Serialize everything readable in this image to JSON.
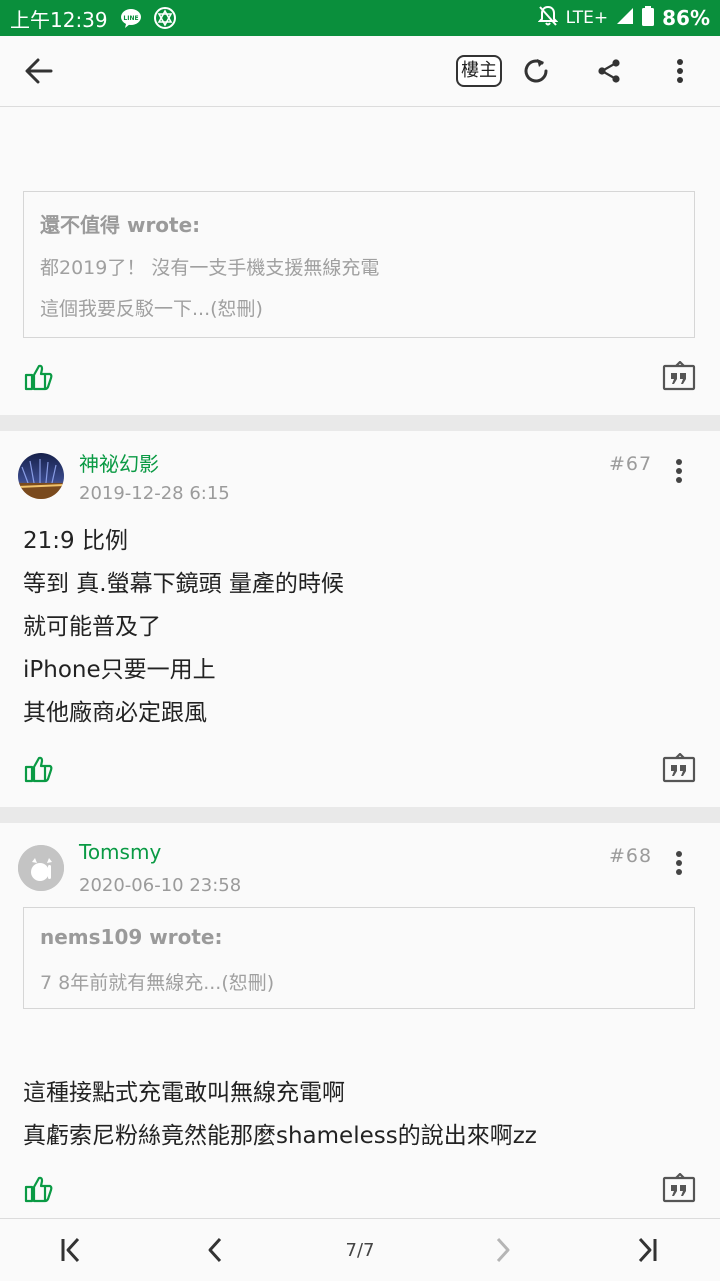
{
  "status_bar": {
    "time": "上午12:39",
    "network": "LTE+",
    "battery": "86%"
  },
  "toolbar": {
    "back_icon": "arrow-left-icon",
    "author_only_label": "樓主",
    "refresh_icon": "refresh-icon",
    "share_icon": "share-icon",
    "more_icon": "more-vertical-icon"
  },
  "posts": [
    {
      "quote": {
        "author": "還不值得 wrote:",
        "lines": [
          "都2019了！ 沒有一支手機支援無線充電",
          "這個我要反駁一下...(恕刪)"
        ]
      }
    },
    {
      "username": "神祕幻影",
      "datetime": "2019-12-28 6:15",
      "floor": "#67",
      "body": [
        "21:9 比例",
        "等到 真.螢幕下鏡頭 量產的時候",
        "就可能普及了",
        "iPhone只要一用上",
        "其他廠商必定跟風"
      ]
    },
    {
      "username": "Tomsmy",
      "datetime": "2020-06-10 23:58",
      "floor": "#68",
      "quote": {
        "author": "nems109 wrote:",
        "lines": [
          "7 8年前就有無線充...(恕刪)"
        ]
      },
      "body": [
        "這種接點式充電敢叫無線充電啊",
        "真虧索尼粉絲竟然能那麼shameless的說出來啊zz"
      ]
    }
  ],
  "pagination": {
    "page_indicator": "7/7"
  },
  "colors": {
    "status_bar": "#0a8f3c",
    "accent_green": "#0a9a44",
    "separator": "#e9e9e9"
  }
}
